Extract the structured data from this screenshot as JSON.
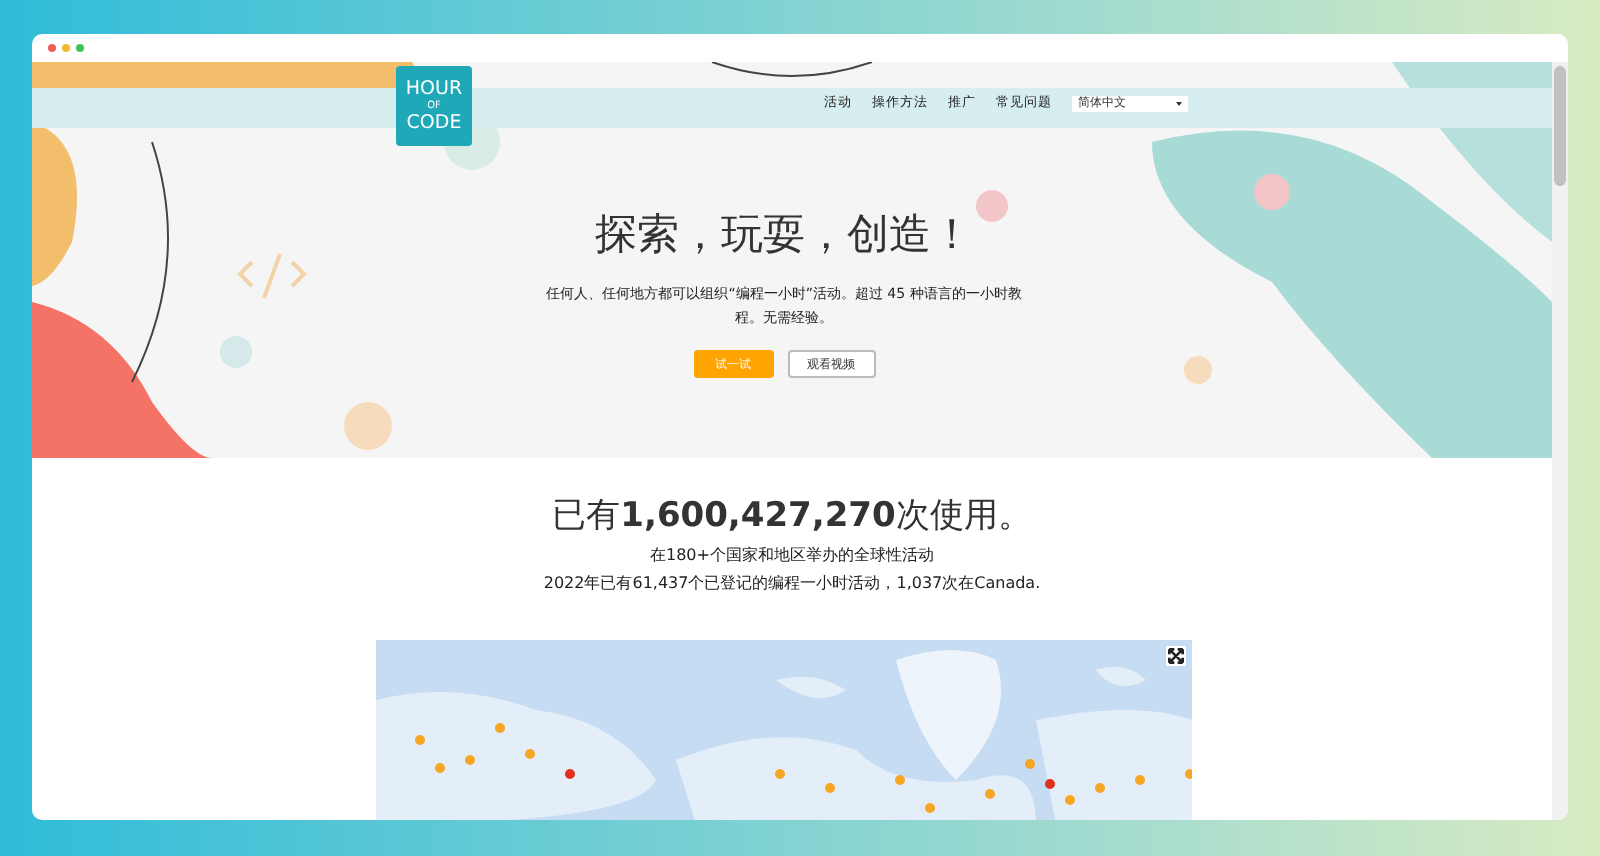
{
  "window": {
    "controls": [
      {
        "color": "#ee5f5b"
      },
      {
        "color": "#f5b731"
      },
      {
        "color": "#3cc35a"
      }
    ]
  },
  "header": {
    "logo": [
      "HOUR",
      "OF",
      "CODE"
    ],
    "nav": [
      {
        "label": "活动"
      },
      {
        "label": "操作方法"
      },
      {
        "label": "推广"
      },
      {
        "label": "常见问题"
      }
    ],
    "language": {
      "value": "简体中文"
    }
  },
  "hero": {
    "title": "探索，玩耍，创造！",
    "text": "任何人、任何地方都可以组织“编程一小时”活动。超过 45 种语言的一小时教程。无需经验。",
    "buttons": [
      {
        "label": "试一试",
        "kind": "primary"
      },
      {
        "label": "观看视频",
        "kind": "secondary"
      }
    ]
  },
  "stats": {
    "headline": "已有**1,600,427,270**次使用。",
    "lines": [
      "在180+个国家和地区举办的全球性活动",
      "2022年已有61,437个已登记的编程一小时活动，1,037次在Canada."
    ]
  }
}
